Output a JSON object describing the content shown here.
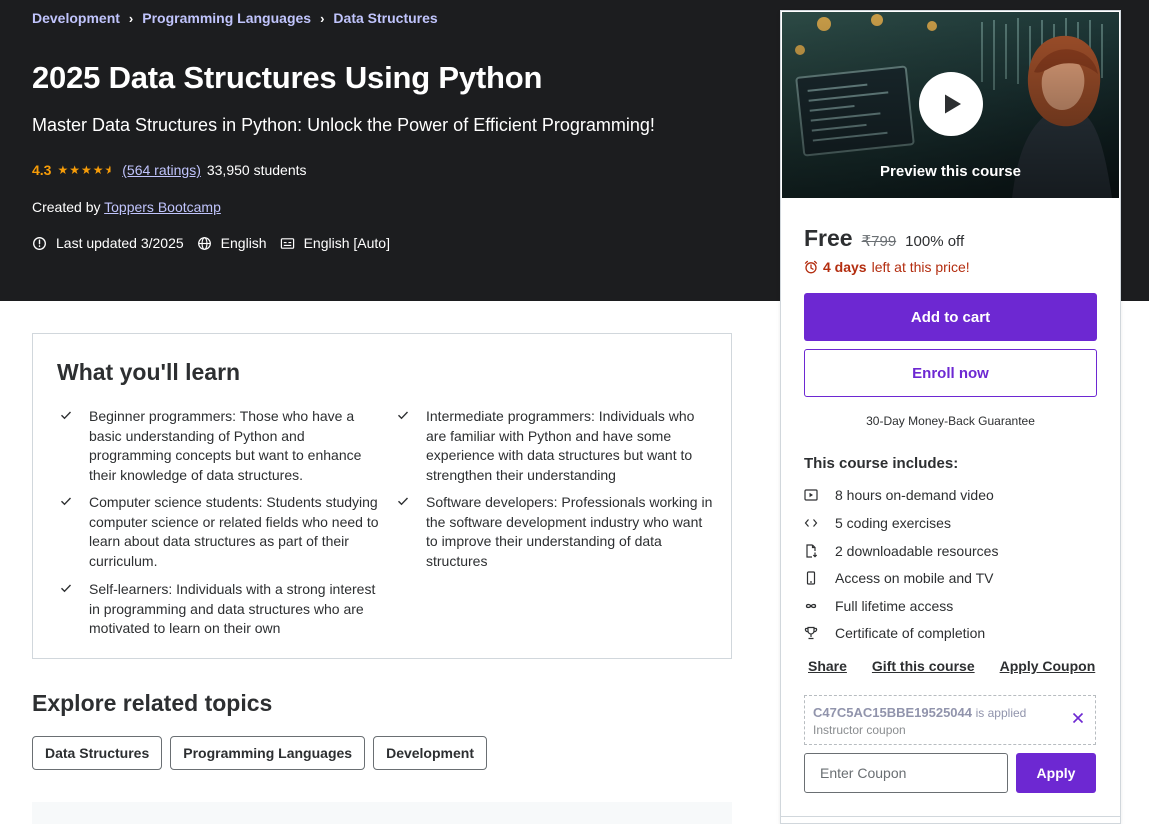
{
  "breadcrumb": {
    "items": [
      "Development",
      "Programming Languages",
      "Data Structures"
    ],
    "separator": "›"
  },
  "course": {
    "title": "2025 Data Structures Using Python",
    "subtitle": "Master Data Structures in Python: Unlock the Power of Efficient Programming!",
    "rating": "4.3",
    "rating_stars": 4.3,
    "ratings_count": "(564 ratings)",
    "students": "33,950 students",
    "created_by_label": "Created by",
    "instructor": "Toppers Bootcamp",
    "last_updated": "Last updated 3/2025",
    "language": "English",
    "captions": "English [Auto]"
  },
  "learn": {
    "heading": "What you'll learn",
    "items": [
      "Beginner programmers: Those who have a basic understanding of Python and programming concepts but want to enhance their knowledge of data structures.",
      "Intermediate programmers: Individuals who are familiar with Python and have some experience with data structures but want to strengthen their understanding",
      "Computer science students: Students studying computer science or related fields who need to learn about data structures as part of their curriculum.",
      "Software developers: Professionals working in the software development industry who want to improve their understanding of data structures",
      "Self-learners: Individuals with a strong interest in programming and data structures who are motivated to learn on their own"
    ]
  },
  "related": {
    "heading": "Explore related topics",
    "topics": [
      "Data Structures",
      "Programming Languages",
      "Development"
    ]
  },
  "sidebar": {
    "preview_label": "Preview this course",
    "price": "Free",
    "original_price": "₹799",
    "discount": "100% off",
    "timer_bold": "4 days",
    "timer_rest": "left at this price!",
    "add_to_cart": "Add to cart",
    "enroll_now": "Enroll now",
    "guarantee": "30-Day Money-Back Guarantee",
    "includes_heading": "This course includes:",
    "includes": [
      {
        "icon": "video-icon",
        "text": "8 hours on-demand video"
      },
      {
        "icon": "code-icon",
        "text": "5 coding exercises"
      },
      {
        "icon": "file-download-icon",
        "text": "2 downloadable resources"
      },
      {
        "icon": "mobile-icon",
        "text": "Access on mobile and TV"
      },
      {
        "icon": "infinity-icon",
        "text": "Full lifetime access"
      },
      {
        "icon": "trophy-icon",
        "text": "Certificate of completion"
      }
    ],
    "actions": [
      "Share",
      "Gift this course",
      "Apply Coupon"
    ],
    "coupon_code": "C47C5AC15BBE19525044",
    "coupon_applied": "is applied",
    "coupon_type": "Instructor coupon",
    "coupon_placeholder": "Enter Coupon",
    "apply_label": "Apply"
  },
  "colors": {
    "hero_bg": "#1c1d1f",
    "accent_purple": "#6d28d2",
    "link_lavender": "#c0c4fc",
    "star_orange": "#f69c08",
    "urgent_red": "#b32d0f"
  }
}
